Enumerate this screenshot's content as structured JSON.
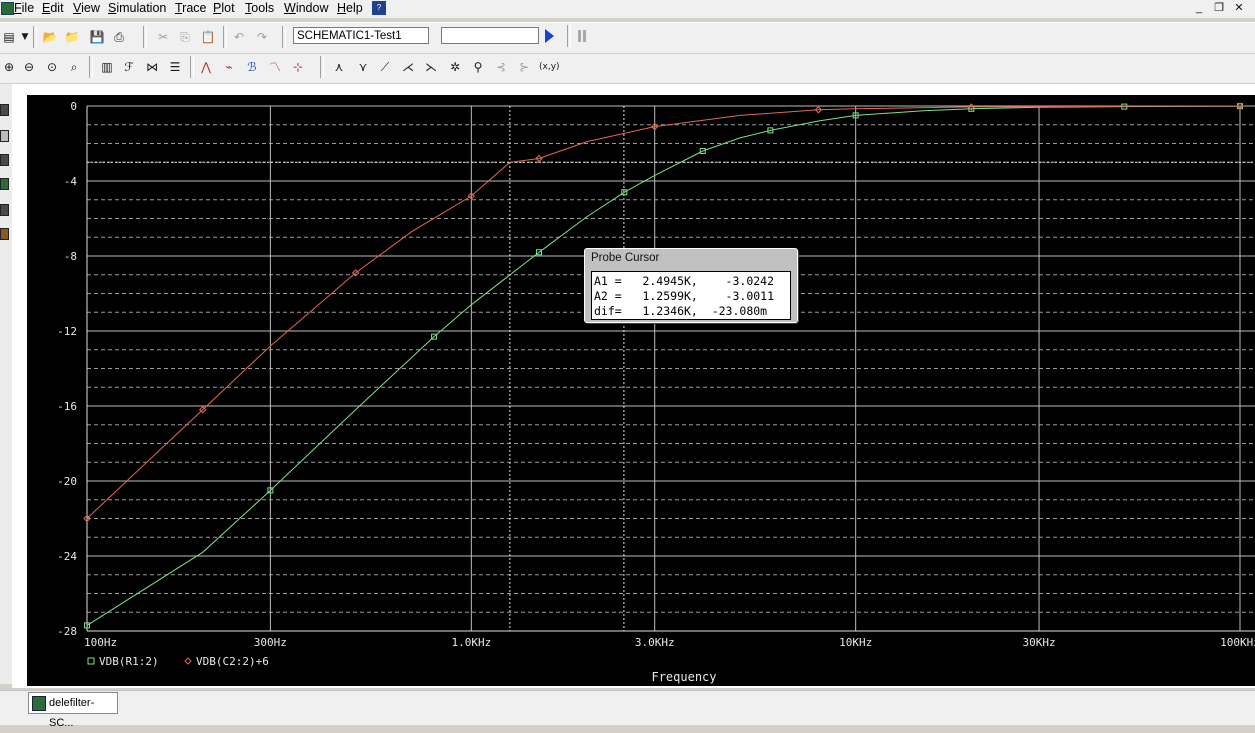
{
  "menu": {
    "items": [
      {
        "pre": "",
        "ul": "F",
        "post": "ile"
      },
      {
        "pre": "",
        "ul": "E",
        "post": "dit"
      },
      {
        "pre": "",
        "ul": "V",
        "post": "iew"
      },
      {
        "pre": "",
        "ul": "S",
        "post": "imulation"
      },
      {
        "pre": "",
        "ul": "T",
        "post": "race"
      },
      {
        "pre": "",
        "ul": "P",
        "post": "lot"
      },
      {
        "pre": "",
        "ul": "T",
        "post": "ools"
      },
      {
        "pre": "",
        "ul": "W",
        "post": "indow"
      },
      {
        "pre": "",
        "ul": "H",
        "post": "elp"
      }
    ]
  },
  "toolbar": {
    "schematic": "SCHEMATIC1-Test1",
    "simulation_profile": ""
  },
  "plot": {
    "xlabel": "Frequency",
    "x_ticks": [
      "100Hz",
      "300Hz",
      "1.0KHz",
      "3.0KHz",
      "10KHz",
      "30KHz",
      "100KHz"
    ],
    "y_ticks": [
      "0",
      "-4",
      "-8",
      "-12",
      "-16",
      "-20",
      "-24",
      "-28"
    ],
    "legend": [
      {
        "marker": "square",
        "label": "VDB(R1:2)",
        "color": "#7fe08a"
      },
      {
        "marker": "diamond",
        "label": "VDB(C2:2)+6",
        "color": "#e06a55"
      }
    ],
    "cursor": {
      "a1_x_hz": 2494.5,
      "a2_x_hz": 1259.9,
      "level_db": -3
    }
  },
  "chart_data": {
    "type": "line",
    "xlabel": "Frequency",
    "ylabel": "",
    "x_scale": "log",
    "xlim_hz": [
      100,
      100000
    ],
    "ylim": [
      -28,
      0
    ],
    "grid": true,
    "legend_placement": "bottom-left",
    "series": [
      {
        "name": "VDB(R1:2)",
        "color": "#7fe08a",
        "points": [
          [
            100,
            -27.7
          ],
          [
            200,
            -23.8
          ],
          [
            300,
            -20.5
          ],
          [
            500,
            -16.2
          ],
          [
            800,
            -12.3
          ],
          [
            1000,
            -10.6
          ],
          [
            1500,
            -7.8
          ],
          [
            2000,
            -5.9
          ],
          [
            2500,
            -4.6
          ],
          [
            3000,
            -3.7
          ],
          [
            4000,
            -2.4
          ],
          [
            5000,
            -1.7
          ],
          [
            6000,
            -1.3
          ],
          [
            8000,
            -0.8
          ],
          [
            10000,
            -0.5
          ],
          [
            15000,
            -0.25
          ],
          [
            20000,
            -0.15
          ],
          [
            30000,
            -0.07
          ],
          [
            50000,
            -0.03
          ],
          [
            100000,
            -0.01
          ]
        ]
      },
      {
        "name": "VDB(C2:2)+6",
        "color": "#e06a55",
        "points": [
          [
            100,
            -22
          ],
          [
            150,
            -18.6
          ],
          [
            200,
            -16.2
          ],
          [
            300,
            -12.8
          ],
          [
            500,
            -8.9
          ],
          [
            700,
            -6.7
          ],
          [
            1000,
            -4.8
          ],
          [
            1259.9,
            -3.0
          ],
          [
            1500,
            -2.8
          ],
          [
            2000,
            -1.9
          ],
          [
            3000,
            -1.1
          ],
          [
            5000,
            -0.5
          ],
          [
            8000,
            -0.2
          ],
          [
            10000,
            -0.15
          ],
          [
            20000,
            -0.05
          ],
          [
            50000,
            -0.01
          ],
          [
            100000,
            0
          ]
        ]
      }
    ]
  },
  "probe_cursor": {
    "title": "Probe Cursor",
    "a1": "A1 =   2.4945K,    -3.0242",
    "a2": "A2 =   1.2599K,    -3.0011",
    "dif": "dif=   1.2346K,  -23.080m"
  },
  "taskbar": {
    "item": "delefilter-SC..."
  }
}
